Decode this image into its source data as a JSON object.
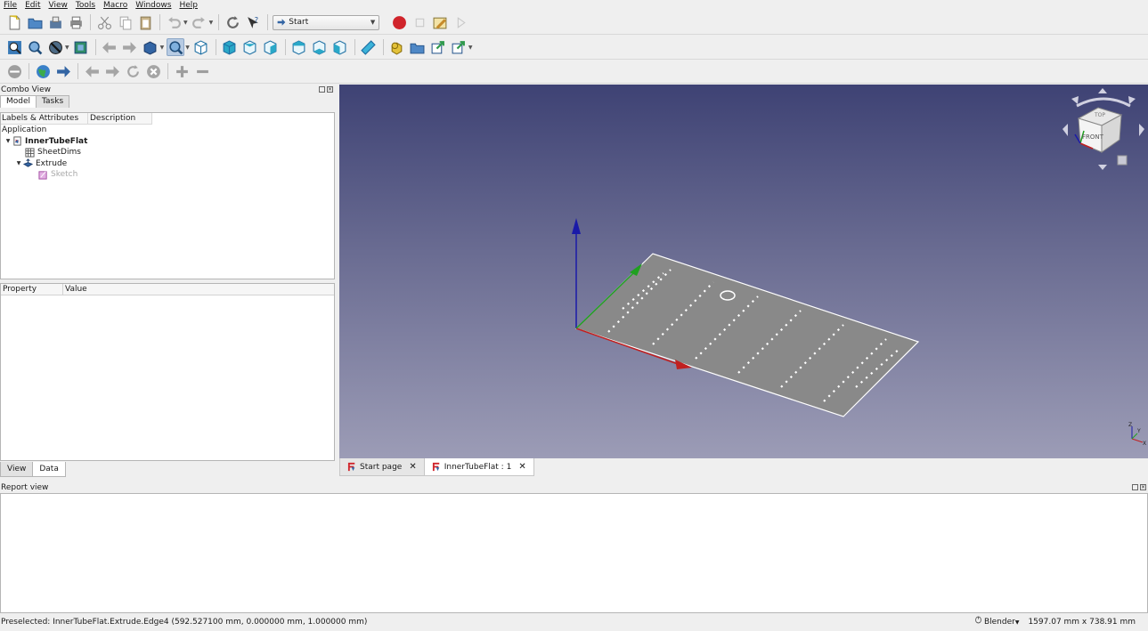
{
  "menu": [
    "File",
    "Edit",
    "View",
    "Tools",
    "Macro",
    "Windows",
    "Help"
  ],
  "workbench": {
    "selected": "Start"
  },
  "combo": {
    "title": "Combo View",
    "tabs": [
      "Model",
      "Tasks"
    ],
    "tree_headers": [
      "Labels & Attributes",
      "Description"
    ],
    "tree": {
      "application": "Application",
      "doc": "InnerTubeFlat",
      "sheet": "SheetDims",
      "extrude": "Extrude",
      "sketch": "Sketch"
    },
    "props_headers": [
      "Property",
      "Value"
    ],
    "bottom_tabs": [
      "View",
      "Data"
    ]
  },
  "doc_tabs": [
    "Start page",
    "InnerTubeFlat : 1"
  ],
  "navcube": {
    "top": "TOP",
    "front": "FRONT"
  },
  "axes": {
    "x": "X",
    "y": "Y",
    "z": "Z"
  },
  "report": {
    "title": "Report view"
  },
  "status": {
    "message": "Preselected: InnerTubeFlat.Extrude.Edge4 (592.527100 mm, 0.000000 mm, 1.000000 mm)",
    "nav_style": "Blender",
    "dimensions": "1597.07 mm x 738.91 mm"
  },
  "colors": {
    "accent": "#3365a4",
    "record": "#d0242b"
  }
}
